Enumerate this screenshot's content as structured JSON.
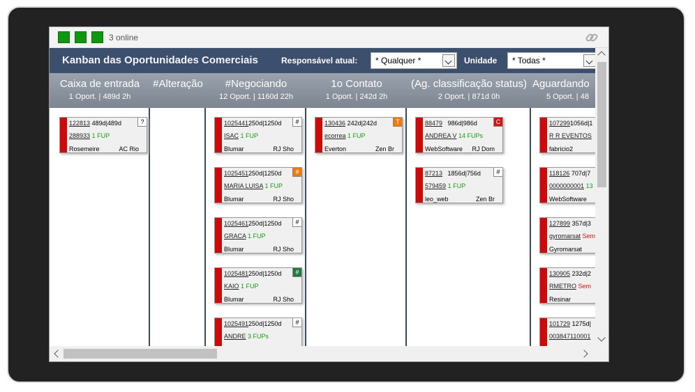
{
  "topbar": {
    "online_text": "3 online"
  },
  "header": {
    "title": "Kanban das Oportunidades Comerciais",
    "responsavel_label": "Responsável atual:",
    "responsavel_value": "* Qualquer *",
    "unidade_label": "Unidade",
    "unidade_value": "* Todas *"
  },
  "columns": [
    {
      "name": "Caixa de entrada",
      "stat": "1 Oport.  |  489d 2h"
    },
    {
      "name": "#Alteração",
      "stat": ""
    },
    {
      "name": "#Negociando",
      "stat": "12 Oport.  |  1160d 22h"
    },
    {
      "name": "1o Contato",
      "stat": "1 Oport.  |  242d 2h"
    },
    {
      "name": "(Ag. classificação status)",
      "stat": "2 Oport.  |  871d 0h"
    },
    {
      "name": "Aguardando",
      "stat": "5 Oport.  |  48"
    }
  ],
  "cards": {
    "c0_0": {
      "id": "122813",
      "time": "489d|489d",
      "badge": "?",
      "sub": "288933",
      "fup": "1 FUP",
      "user": "Rosemeire",
      "unit": "AC Rio"
    },
    "c2_0": {
      "id": "1025441",
      "time": "250d|1250d",
      "badge": "#",
      "sub": "ISAC",
      "fup": "1 FUP",
      "user": "Blumar",
      "unit": "RJ Sho"
    },
    "c2_1": {
      "id": "1025451",
      "time": "250d|1250d",
      "badge": "#",
      "sub": "MARIA LUISA",
      "fup": "1 FUP",
      "user": "Blumar",
      "unit": "RJ Sho"
    },
    "c2_2": {
      "id": "1025461",
      "time": "250d|1250d",
      "badge": "#",
      "sub": "GRACA",
      "fup": "1 FUP",
      "user": "Blumar",
      "unit": "RJ Sho"
    },
    "c2_3": {
      "id": "1025481",
      "time": "250d|1250d",
      "badge": "#",
      "sub": "KAIO",
      "fup": "1 FUP",
      "user": "Blumar",
      "unit": "RJ Sho"
    },
    "c2_4": {
      "id": "1025491",
      "time": "250d|1250d",
      "badge": "#",
      "sub": "ANDRE",
      "fup": "3 FUPs",
      "user": "",
      "unit": ""
    },
    "c3_0": {
      "id": "130436",
      "time": "242d|242d",
      "badge": "T",
      "sub": "ecorrea",
      "fup": "1 FUP",
      "user": "Everton",
      "unit": "Zen Br"
    },
    "c4_0": {
      "id": "88479",
      "time": "986d|986d",
      "badge": "C",
      "sub": "ANDREA V",
      "fup": "14 FUPs",
      "user": "WebSoftware",
      "unit": "RJ Dom"
    },
    "c4_1": {
      "id": "87213",
      "time": "1856d|756d",
      "badge": "#",
      "sub": "579459",
      "fup": "1 FUP",
      "user": "leo_web",
      "unit": "Zen Br"
    },
    "c5_0": {
      "id": "107299",
      "time": "1056d|1",
      "badge": "",
      "sub": "R R EVENTOS",
      "fup": "",
      "user": "fabricio2",
      "unit": ""
    },
    "c5_1": {
      "id": "118126",
      "time": "707d|7",
      "badge": "",
      "sub": "0000000001",
      "fup": "13",
      "user": "WebSoftware",
      "unit": ""
    },
    "c5_2": {
      "id": "127899",
      "time": "357d|3",
      "badge": "",
      "sub": "gyromarsat",
      "fup": "Sem",
      "user": "Gyromarsat",
      "unit": ""
    },
    "c5_3": {
      "id": "130905",
      "time": "232d|2",
      "badge": "",
      "sub": "RMETRO",
      "fup": "Sem",
      "user": "Resinar",
      "unit": ""
    },
    "c5_4": {
      "id": "101729",
      "time": "1275d|",
      "badge": "",
      "sub": "003847110001",
      "fup": "",
      "user": "",
      "unit": ""
    }
  },
  "colors": {
    "header_bg": "#3c4f6d",
    "card_bar": "#cc0a0a",
    "fup_green": "#129b12",
    "badge_orange": "#ee7a0c",
    "badge_red": "#d01414",
    "badge_green": "#1f7a3c"
  }
}
